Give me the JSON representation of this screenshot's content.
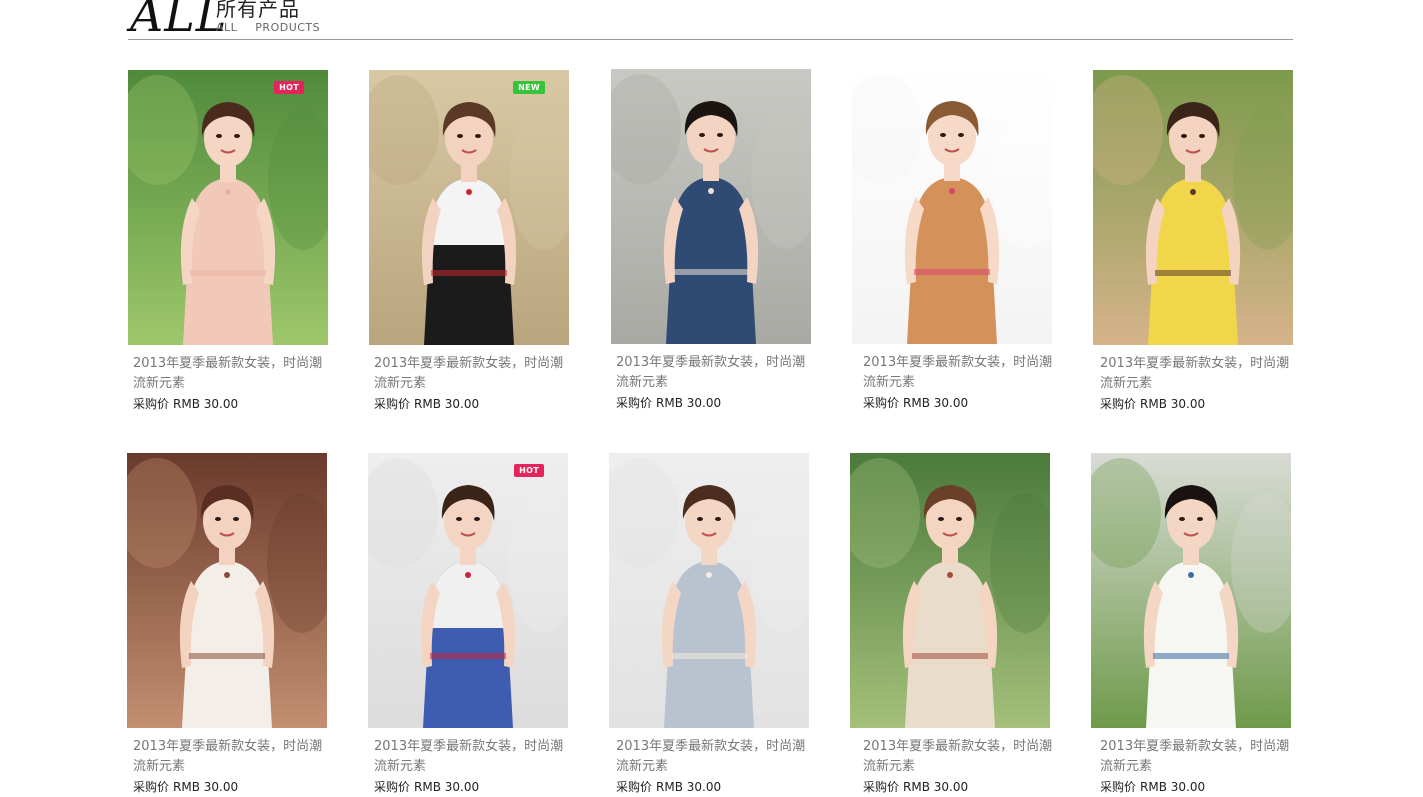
{
  "header": {
    "title_big": "ALL",
    "title_cn": "所有产品",
    "title_en_1": "ALL",
    "title_en_2": "PRODUCTS"
  },
  "products": [
    {
      "title": "2013年夏季最新款女装，时尚潮流新元素",
      "price_label": "采购价",
      "price": "RMB 30.00",
      "badge": "HOT",
      "badge_color": "#e4245a"
    },
    {
      "title": "2013年夏季最新款女装，时尚潮流新元素",
      "price_label": "采购价",
      "price": "RMB 30.00",
      "badge": "NEW",
      "badge_color": "#39c33a"
    },
    {
      "title": "2013年夏季最新款女装，时尚潮流新元素",
      "price_label": "采购价",
      "price": "RMB 30.00",
      "badge": "",
      "badge_color": ""
    },
    {
      "title": "2013年夏季最新款女装，时尚潮流新元素",
      "price_label": "采购价",
      "price": "RMB 30.00",
      "badge": "",
      "badge_color": ""
    },
    {
      "title": "2013年夏季最新款女装，时尚潮流新元素",
      "price_label": "采购价",
      "price": "RMB 30.00",
      "badge": "",
      "badge_color": ""
    },
    {
      "title": "2013年夏季最新款女装，时尚潮流新元素",
      "price_label": "采购价",
      "price": "RMB 30.00",
      "badge": "",
      "badge_color": ""
    },
    {
      "title": "2013年夏季最新款女装，时尚潮流新元素",
      "price_label": "采购价",
      "price": "RMB 30.00",
      "badge": "HOT",
      "badge_color": "#e4245a"
    },
    {
      "title": "2013年夏季最新款女装，时尚潮流新元素",
      "price_label": "采购价",
      "price": "RMB 30.00",
      "badge": "",
      "badge_color": ""
    },
    {
      "title": "2013年夏季最新款女装，时尚潮流新元素",
      "price_label": "采购价",
      "price": "RMB 30.00",
      "badge": "",
      "badge_color": ""
    },
    {
      "title": "2013年夏季最新款女装，时尚潮流新元素",
      "price_label": "采购价",
      "price": "RMB 30.00",
      "badge": "",
      "badge_color": ""
    }
  ]
}
